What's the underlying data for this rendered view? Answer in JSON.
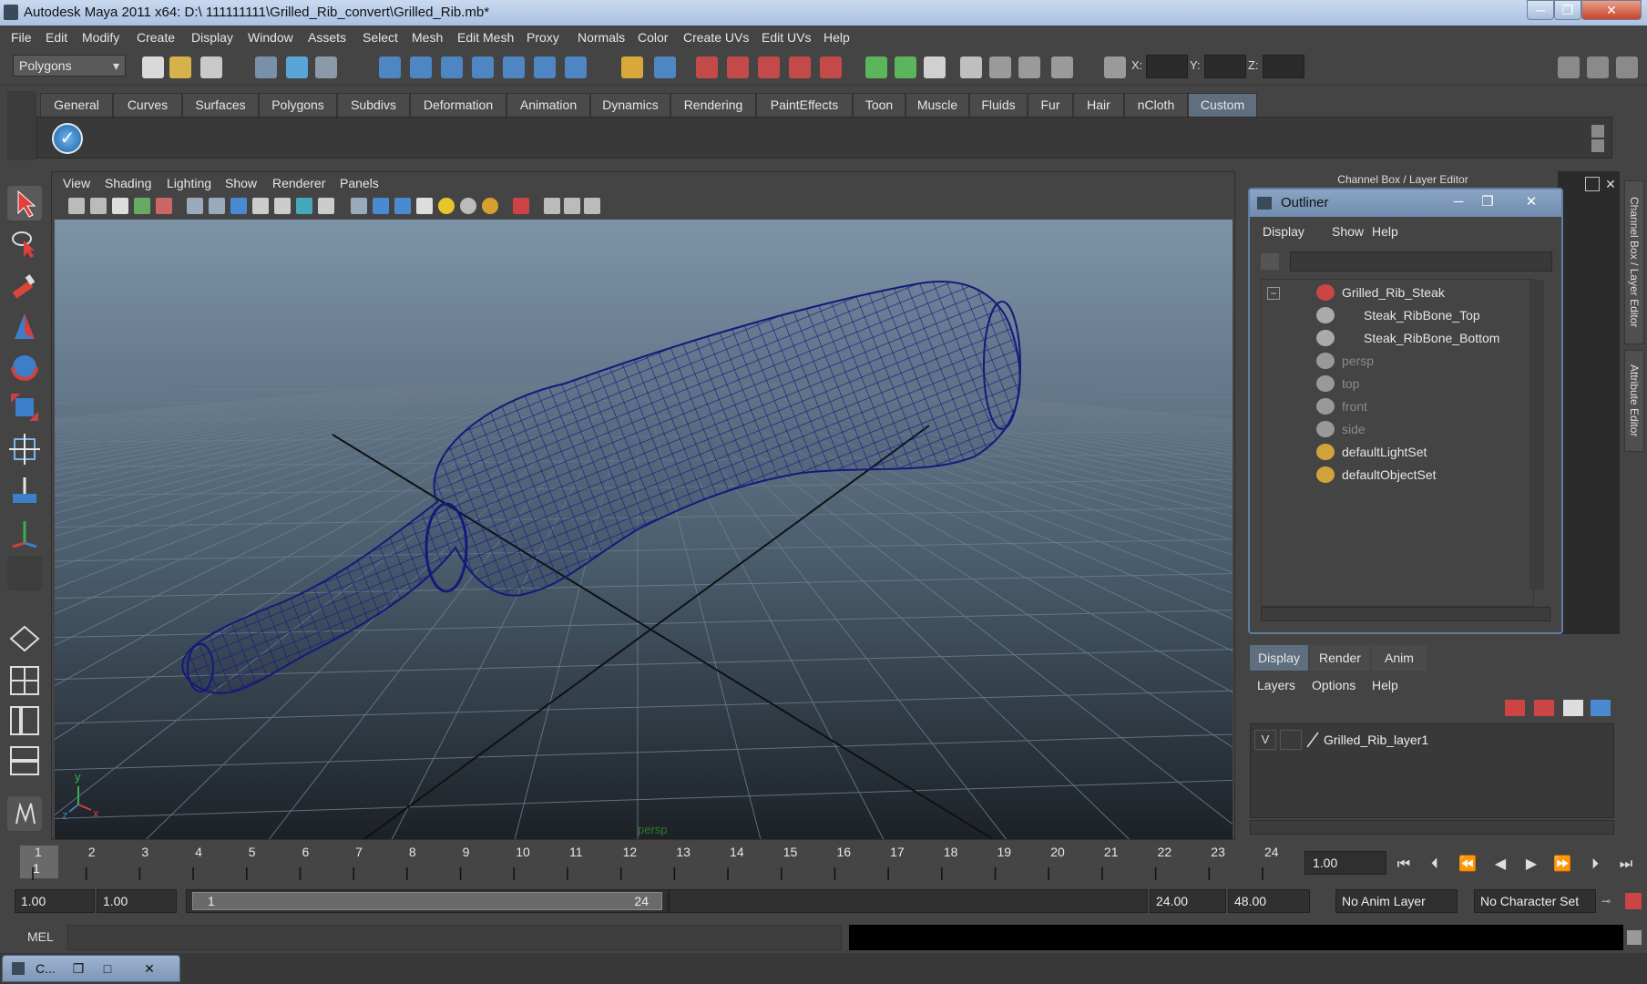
{
  "window": {
    "title": "Autodesk Maya 2011 x64: D:\\ 111111111\\Grilled_Rib_convert\\Grilled_Rib.mb*"
  },
  "menubar": [
    "File",
    "Edit",
    "Modify",
    "Create",
    "Display",
    "Window",
    "Assets",
    "Select",
    "Mesh",
    "Edit Mesh",
    "Proxy",
    "Normals",
    "Color",
    "Create UVs",
    "Edit UVs",
    "Help"
  ],
  "status_line": {
    "mode": "Polygons",
    "x_label": "X:",
    "y_label": "Y:",
    "z_label": "Z:"
  },
  "shelf": {
    "tabs": [
      "General",
      "Curves",
      "Surfaces",
      "Polygons",
      "Subdivs",
      "Deformation",
      "Animation",
      "Dynamics",
      "Rendering",
      "PaintEffects",
      "Toon",
      "Muscle",
      "Fluids",
      "Fur",
      "Hair",
      "nCloth",
      "Custom"
    ],
    "active_tab": "Custom"
  },
  "viewport": {
    "menu": [
      "View",
      "Shading",
      "Lighting",
      "Show",
      "Renderer",
      "Panels"
    ],
    "camera_label": "persp"
  },
  "channel_box": {
    "title": "Channel Box / Layer Editor"
  },
  "side_tabs": [
    "Channel Box / Layer Editor",
    "Attribute Editor"
  ],
  "outliner": {
    "title": "Outliner",
    "menu": [
      "Display",
      "Show",
      "Help"
    ],
    "items": [
      {
        "label": "Grilled_Rib_Steak",
        "indent": 0,
        "dimmed": false,
        "icon": "transform-icon"
      },
      {
        "label": "Steak_RibBone_Top",
        "indent": 1,
        "dimmed": false,
        "icon": "mesh-icon"
      },
      {
        "label": "Steak_RibBone_Bottom",
        "indent": 1,
        "dimmed": false,
        "icon": "mesh-icon"
      },
      {
        "label": "persp",
        "indent": 0,
        "dimmed": true,
        "icon": "camera-icon"
      },
      {
        "label": "top",
        "indent": 0,
        "dimmed": true,
        "icon": "camera-icon"
      },
      {
        "label": "front",
        "indent": 0,
        "dimmed": true,
        "icon": "camera-icon"
      },
      {
        "label": "side",
        "indent": 0,
        "dimmed": true,
        "icon": "camera-icon"
      },
      {
        "label": "defaultLightSet",
        "indent": 0,
        "dimmed": false,
        "icon": "set-icon"
      },
      {
        "label": "defaultObjectSet",
        "indent": 0,
        "dimmed": false,
        "icon": "set-icon"
      }
    ]
  },
  "layer_editor": {
    "tabs": [
      "Display",
      "Render",
      "Anim"
    ],
    "active_tab": "Display",
    "menu": [
      "Layers",
      "Options",
      "Help"
    ],
    "layers": [
      {
        "visible": "V",
        "name": "Grilled_Rib_layer1"
      }
    ]
  },
  "timeline": {
    "ticks": [
      "1",
      "2",
      "3",
      "4",
      "5",
      "6",
      "7",
      "8",
      "9",
      "10",
      "11",
      "12",
      "13",
      "14",
      "15",
      "16",
      "17",
      "18",
      "19",
      "20",
      "21",
      "22",
      "23",
      "24"
    ],
    "current_frame": "1",
    "current_time": "1.00"
  },
  "range_slider": {
    "start_time": "1.00",
    "playback_start": "1.00",
    "range_start": "1",
    "range_end": "24",
    "playback_end": "24.00",
    "end_time": "48.00",
    "anim_layer": "No Anim Layer",
    "character_set": "No Character Set"
  },
  "command_line": {
    "label": "MEL"
  },
  "taskbar": {
    "minimized_label": "C..."
  },
  "colors": {
    "wireframe": "#141a7a",
    "grid": "#6c7d8c",
    "accent": "#5f6f80"
  }
}
